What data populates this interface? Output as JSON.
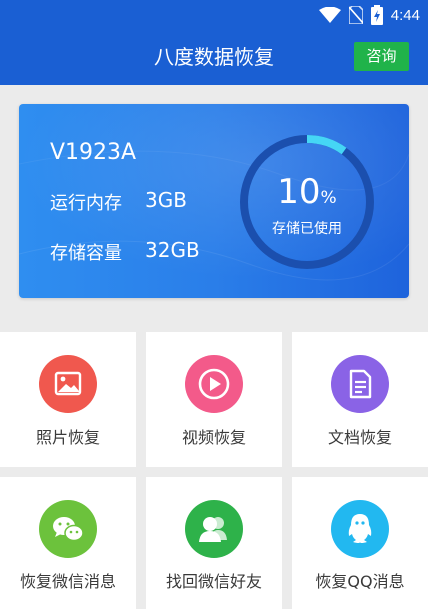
{
  "status_bar": {
    "time": "4:44",
    "icons": [
      "wifi-icon",
      "no-sim-icon",
      "battery-charging-icon"
    ]
  },
  "app_bar": {
    "title": "八度数据恢复",
    "consult_label": "咨询"
  },
  "device": {
    "model": "V1923A",
    "ram_label": "运行内存",
    "ram_value": "3GB",
    "storage_label": "存储容量",
    "storage_value": "32GB",
    "used_percent": 10,
    "used_percent_text": "10",
    "used_unit": "%",
    "used_caption": "存储已使用"
  },
  "tiles": [
    {
      "label": "照片恢复",
      "icon": "photo-icon",
      "color": "#f0584e"
    },
    {
      "label": "视频恢复",
      "icon": "video-play-icon",
      "color": "#f35a8a"
    },
    {
      "label": "文档恢复",
      "icon": "document-icon",
      "color": "#8a63e6"
    },
    {
      "label": "恢复微信消息",
      "icon": "wechat-icon",
      "color": "#6cc23c"
    },
    {
      "label": "找回微信好友",
      "icon": "contacts-icon",
      "color": "#2eb24a"
    },
    {
      "label": "恢复QQ消息",
      "icon": "qq-icon",
      "color": "#22b8f0"
    }
  ],
  "colors": {
    "primary": "#1a5fd3",
    "accent_green": "#20b34a",
    "gauge_progress": "#45d6f5",
    "gauge_track": "#1b4fae"
  }
}
